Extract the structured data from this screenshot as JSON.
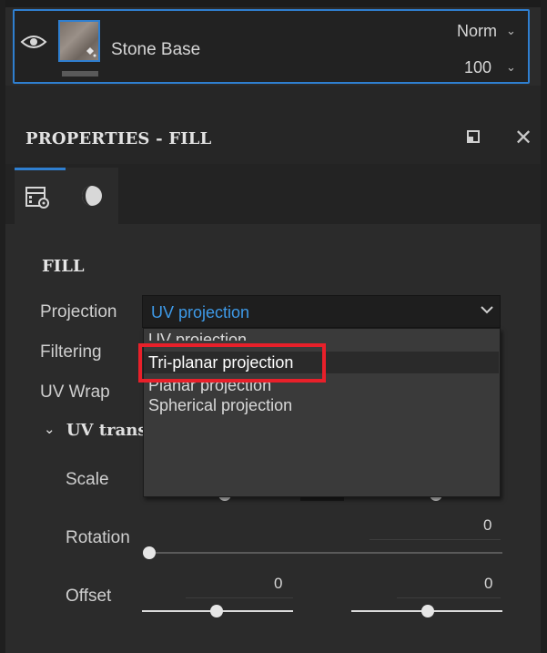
{
  "layer": {
    "name": "Stone Base",
    "blend_mode": "Norm",
    "opacity": "100"
  },
  "panel": {
    "title": "PROPERTIES - FILL",
    "section_title": "FILL",
    "tabs": [
      {
        "icon": "fill-settings-icon",
        "active": true
      },
      {
        "icon": "material-sphere-icon",
        "active": false
      }
    ]
  },
  "fields": {
    "projection_label": "Projection",
    "projection_value": "UV projection",
    "filtering_label": "Filtering",
    "uvwrap_label": "UV Wrap",
    "uvtrans_label": "UV trans",
    "scale_label": "Scale",
    "rotation_label": "Rotation",
    "rotation_value": "0",
    "offset_label": "Offset",
    "offset_u_value": "0",
    "offset_v_value": "0"
  },
  "dropdown": {
    "options": [
      "UV projection",
      "Tri-planar projection",
      "Planar projection",
      "Spherical projection"
    ],
    "hovered": "Tri-planar projection"
  },
  "colors": {
    "accent": "#2f7fd0",
    "selected_text": "#3e9ae8",
    "highlight_box": "#e8202a"
  }
}
